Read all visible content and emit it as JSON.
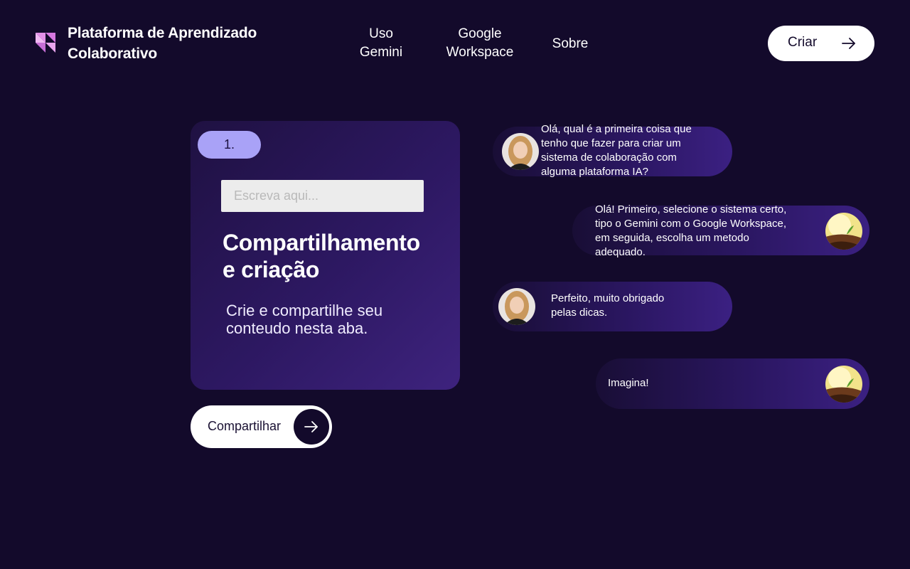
{
  "header": {
    "brand_line1": "Plataforma de Aprendizado",
    "brand_line2": "Colaborativo",
    "logo_icon": "triangles-logo-icon",
    "nav": [
      {
        "line1": "Uso",
        "line2": "Gemini"
      },
      {
        "line1": "Google",
        "line2": "Workspace"
      },
      {
        "line1": "Sobre",
        "line2": ""
      }
    ],
    "create_label": "Criar",
    "create_icon": "arrow-right-icon"
  },
  "card": {
    "step": "1.",
    "input_placeholder": "Escreva aqui...",
    "title_line1": "Compartilhamento",
    "title_line2": "e criação",
    "desc_line1": "Crie e compartilhe seu",
    "desc_line2": "conteudo nesta aba."
  },
  "share": {
    "label": "Compartilhar",
    "icon": "arrow-right-icon"
  },
  "chat": [
    {
      "side": "left",
      "avatar": "woman-avatar",
      "lines": [
        "Olá, qual é a primeira coisa que",
        "tenho que fazer para criar um",
        "sistema de colaboração com",
        "alguma plataforma IA?"
      ]
    },
    {
      "side": "right",
      "avatar": "plant-avatar",
      "lines": [
        "Olá! Primeiro, selecione o sistema certo,",
        "tipo o Gemini com o Google Workspace,",
        "em seguida, escolha um metodo",
        "adequado."
      ]
    },
    {
      "side": "left",
      "avatar": "woman-avatar",
      "lines": [
        "Perfeito, muito obrigado",
        "pelas dicas."
      ]
    },
    {
      "side": "right",
      "avatar": "plant-avatar",
      "lines": [
        "Imagina!"
      ]
    }
  ],
  "colors": {
    "background": "#130a2b",
    "pill": "#a9a2f7",
    "accent_purple": "#3e237e",
    "logo_pink": "#e38fe8"
  }
}
